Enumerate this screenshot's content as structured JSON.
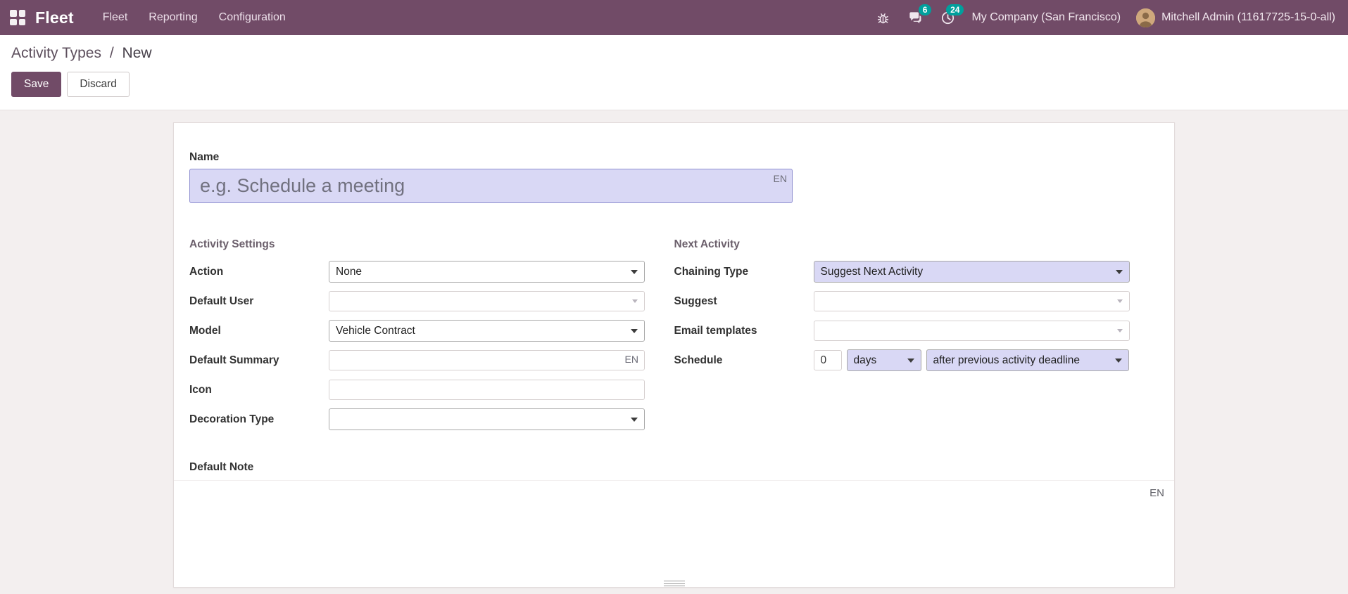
{
  "colors": {
    "navbar": "#714B67",
    "badge": "#00A09D",
    "field_highlight": "#D9D8F5",
    "page_background": "#F3EFEF"
  },
  "navbar": {
    "brand": "Fleet",
    "menus": [
      {
        "label": "Fleet"
      },
      {
        "label": "Reporting"
      },
      {
        "label": "Configuration"
      }
    ],
    "systray": {
      "messages_count": "6",
      "activities_count": "24",
      "company": "My Company (San Francisco)",
      "user": "Mitchell Admin (11617725-15-0-all)"
    }
  },
  "breadcrumb": {
    "parent": "Activity Types",
    "separator": "/",
    "current": "New"
  },
  "actions": {
    "save": "Save",
    "discard": "Discard"
  },
  "form": {
    "name": {
      "label": "Name",
      "placeholder": "e.g. Schedule a meeting",
      "value": "",
      "lang": "EN"
    },
    "left_group": {
      "title": "Activity Settings",
      "fields": {
        "action": {
          "label": "Action",
          "value": "None"
        },
        "default_user": {
          "label": "Default User",
          "value": ""
        },
        "model": {
          "label": "Model",
          "value": "Vehicle Contract"
        },
        "default_summary": {
          "label": "Default Summary",
          "value": "",
          "lang": "EN"
        },
        "icon": {
          "label": "Icon",
          "value": ""
        },
        "decoration_type": {
          "label": "Decoration Type",
          "value": ""
        }
      }
    },
    "right_group": {
      "title": "Next Activity",
      "fields": {
        "chaining_type": {
          "label": "Chaining Type",
          "value": "Suggest Next Activity"
        },
        "suggest": {
          "label": "Suggest",
          "value": ""
        },
        "email_templates": {
          "label": "Email templates",
          "value": ""
        },
        "schedule": {
          "label": "Schedule",
          "number": "0",
          "unit": "days",
          "relative": "after previous activity deadline"
        }
      }
    },
    "default_note": {
      "label": "Default Note",
      "value": "",
      "lang": "EN"
    }
  }
}
